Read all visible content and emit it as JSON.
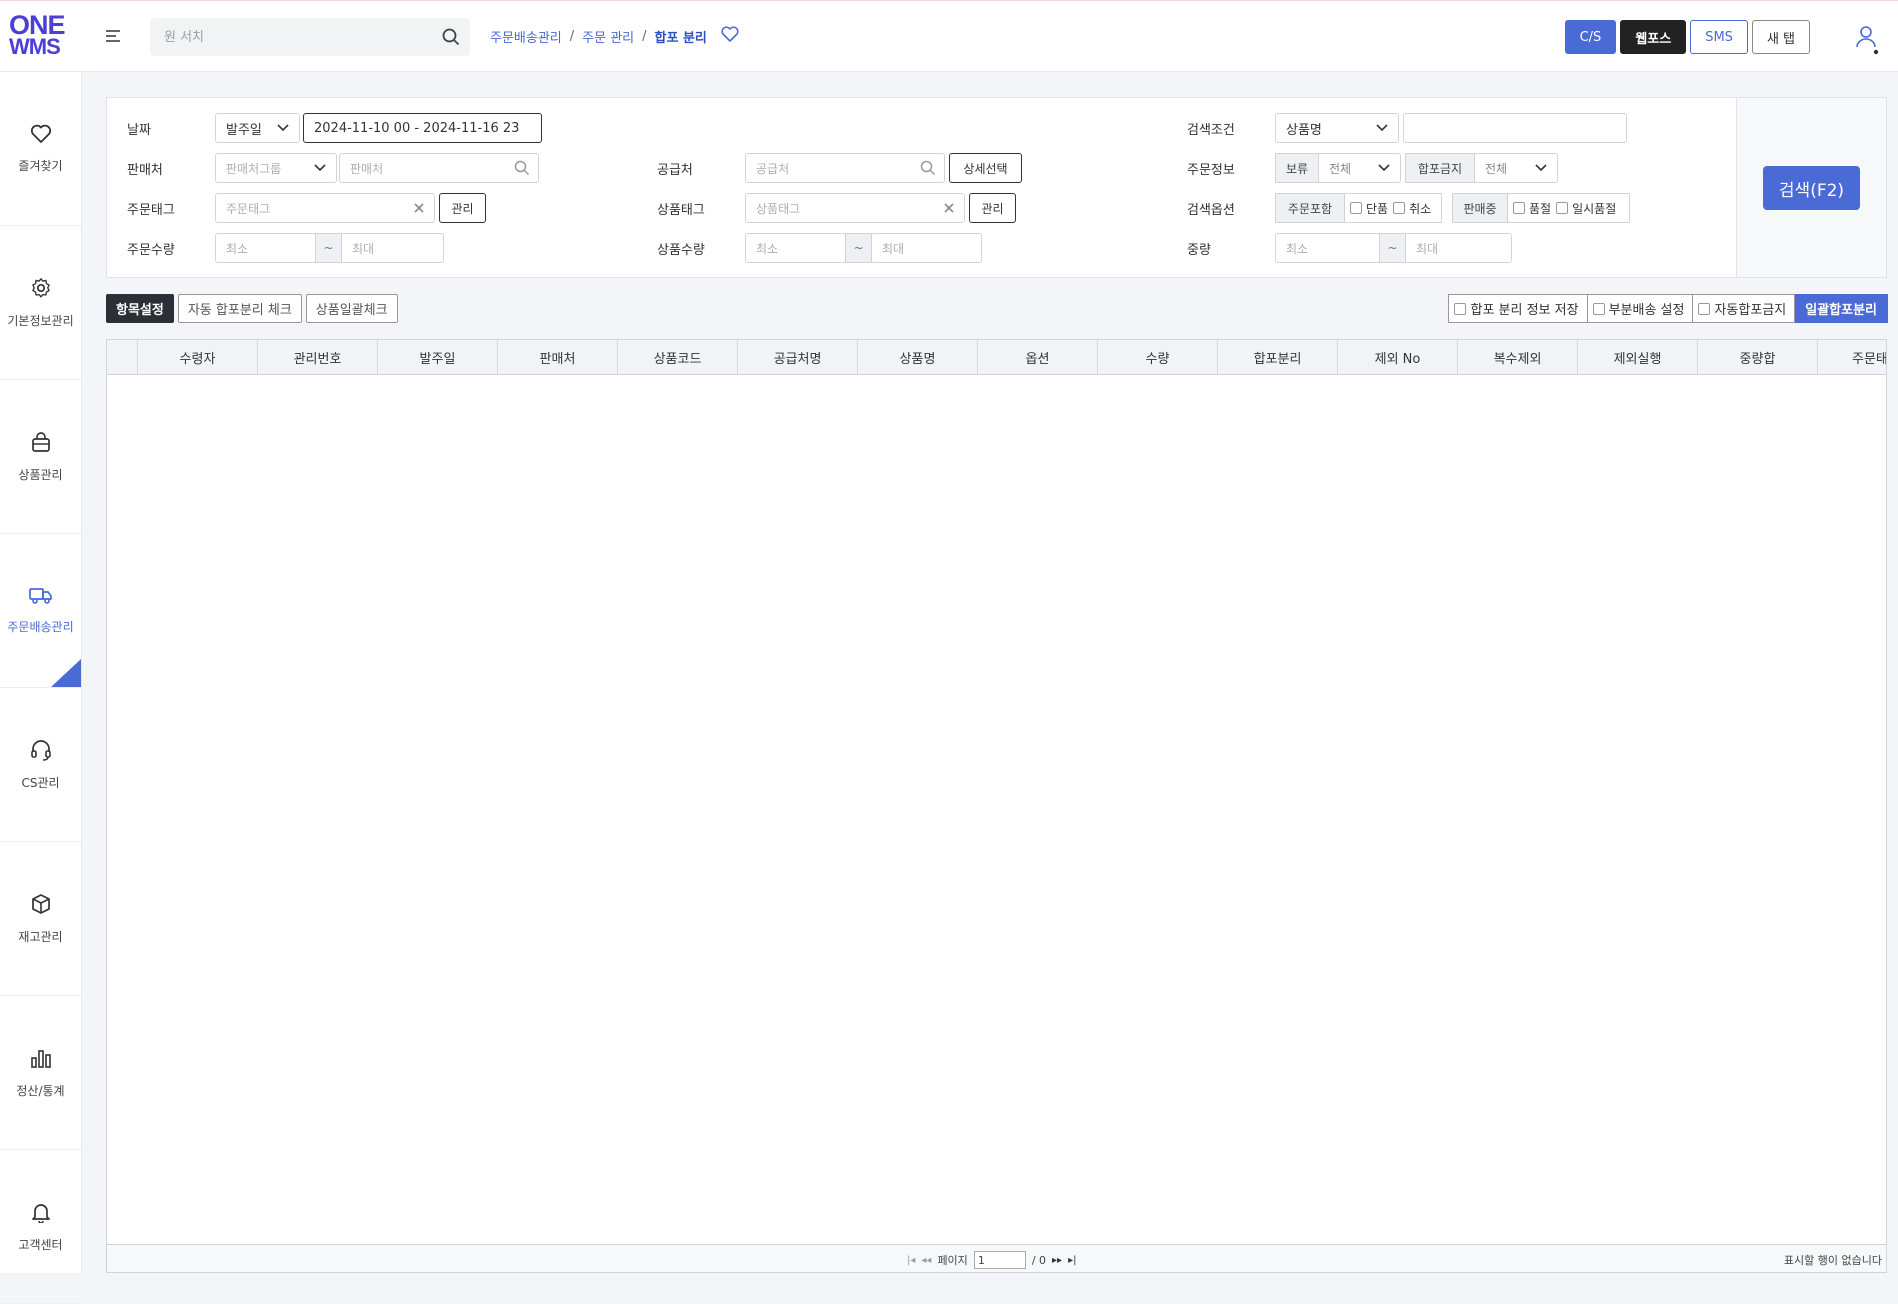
{
  "header": {
    "logo_line1": "ONE",
    "logo_line2": "WMS",
    "search_placeholder": "원 서치",
    "breadcrumb": [
      "주문배송관리",
      "주문 관리",
      "합포 분리"
    ],
    "buttons": [
      "C/S",
      "웹포스",
      "SMS",
      "새 탭"
    ]
  },
  "sidebar": {
    "items": [
      {
        "label": "즐겨찾기",
        "icon": "heart-icon"
      },
      {
        "label": "기본정보관리",
        "icon": "gear-icon"
      },
      {
        "label": "상품관리",
        "icon": "bag-icon"
      },
      {
        "label": "주문배송관리",
        "icon": "truck-icon",
        "active": true
      },
      {
        "label": "CS관리",
        "icon": "headset-icon"
      },
      {
        "label": "재고관리",
        "icon": "box-icon"
      },
      {
        "label": "정산/통계",
        "icon": "bar-chart-icon"
      },
      {
        "label": "고객센터",
        "icon": "bell-icon"
      }
    ]
  },
  "filter": {
    "date_label": "날짜",
    "date_type": "발주일",
    "date_range": "2024-11-10 00 - 2024-11-16 23",
    "search_cond_label": "검색조건",
    "search_cond_value": "상품명",
    "seller_label": "판매처",
    "seller_group_placeholder": "판매처그룹",
    "seller_placeholder": "판매처",
    "supplier_label": "공급처",
    "supplier_placeholder": "공급처",
    "detail_select": "상세선택",
    "order_info_label": "주문정보",
    "hold_tag": "보류",
    "hold_value": "전체",
    "merge_ban_tag": "합포금지",
    "merge_ban_value": "전체",
    "order_tag_label": "주문태그",
    "order_tag_placeholder": "주문태그",
    "manage": "관리",
    "product_tag_label": "상품태그",
    "product_tag_placeholder": "상품태그",
    "search_option_label": "검색옵션",
    "order_include_tag": "주문포함",
    "opt_single": "단품",
    "opt_cancel": "취소",
    "on_sale_tag": "판매중",
    "opt_soldout": "품절",
    "opt_temp_soldout": "일시품절",
    "order_qty_label": "주문수량",
    "product_qty_label": "상품수량",
    "weight_label": "중량",
    "min": "최소",
    "max": "최대",
    "tilde": "~",
    "search_button": "검색(F2)"
  },
  "toolbar": {
    "left": [
      "항목설정",
      "자동 합포분리 체크",
      "상품일괄체크"
    ],
    "save_info": "합포 분리 정보 저장",
    "partial_ship": "부분배송 설정",
    "auto_merge_ban": "자동합포금지",
    "bulk_split": "일괄합포분리"
  },
  "grid": {
    "columns": [
      "",
      "수령자",
      "관리번호",
      "발주일",
      "판매처",
      "상품코드",
      "공급처명",
      "상품명",
      "옵션",
      "수량",
      "합포분리",
      "제외 No",
      "복수제외",
      "제외실행",
      "중량합",
      "주문태"
    ],
    "rows": [],
    "page_label": "페이지",
    "page_value": "1",
    "page_total": "/ 0",
    "no_rows": "표시할 행이 없습니다"
  },
  "colors": {
    "accent": "#4a6ad6",
    "dark": "#2d2f36",
    "logo": "#4b3fd6"
  }
}
